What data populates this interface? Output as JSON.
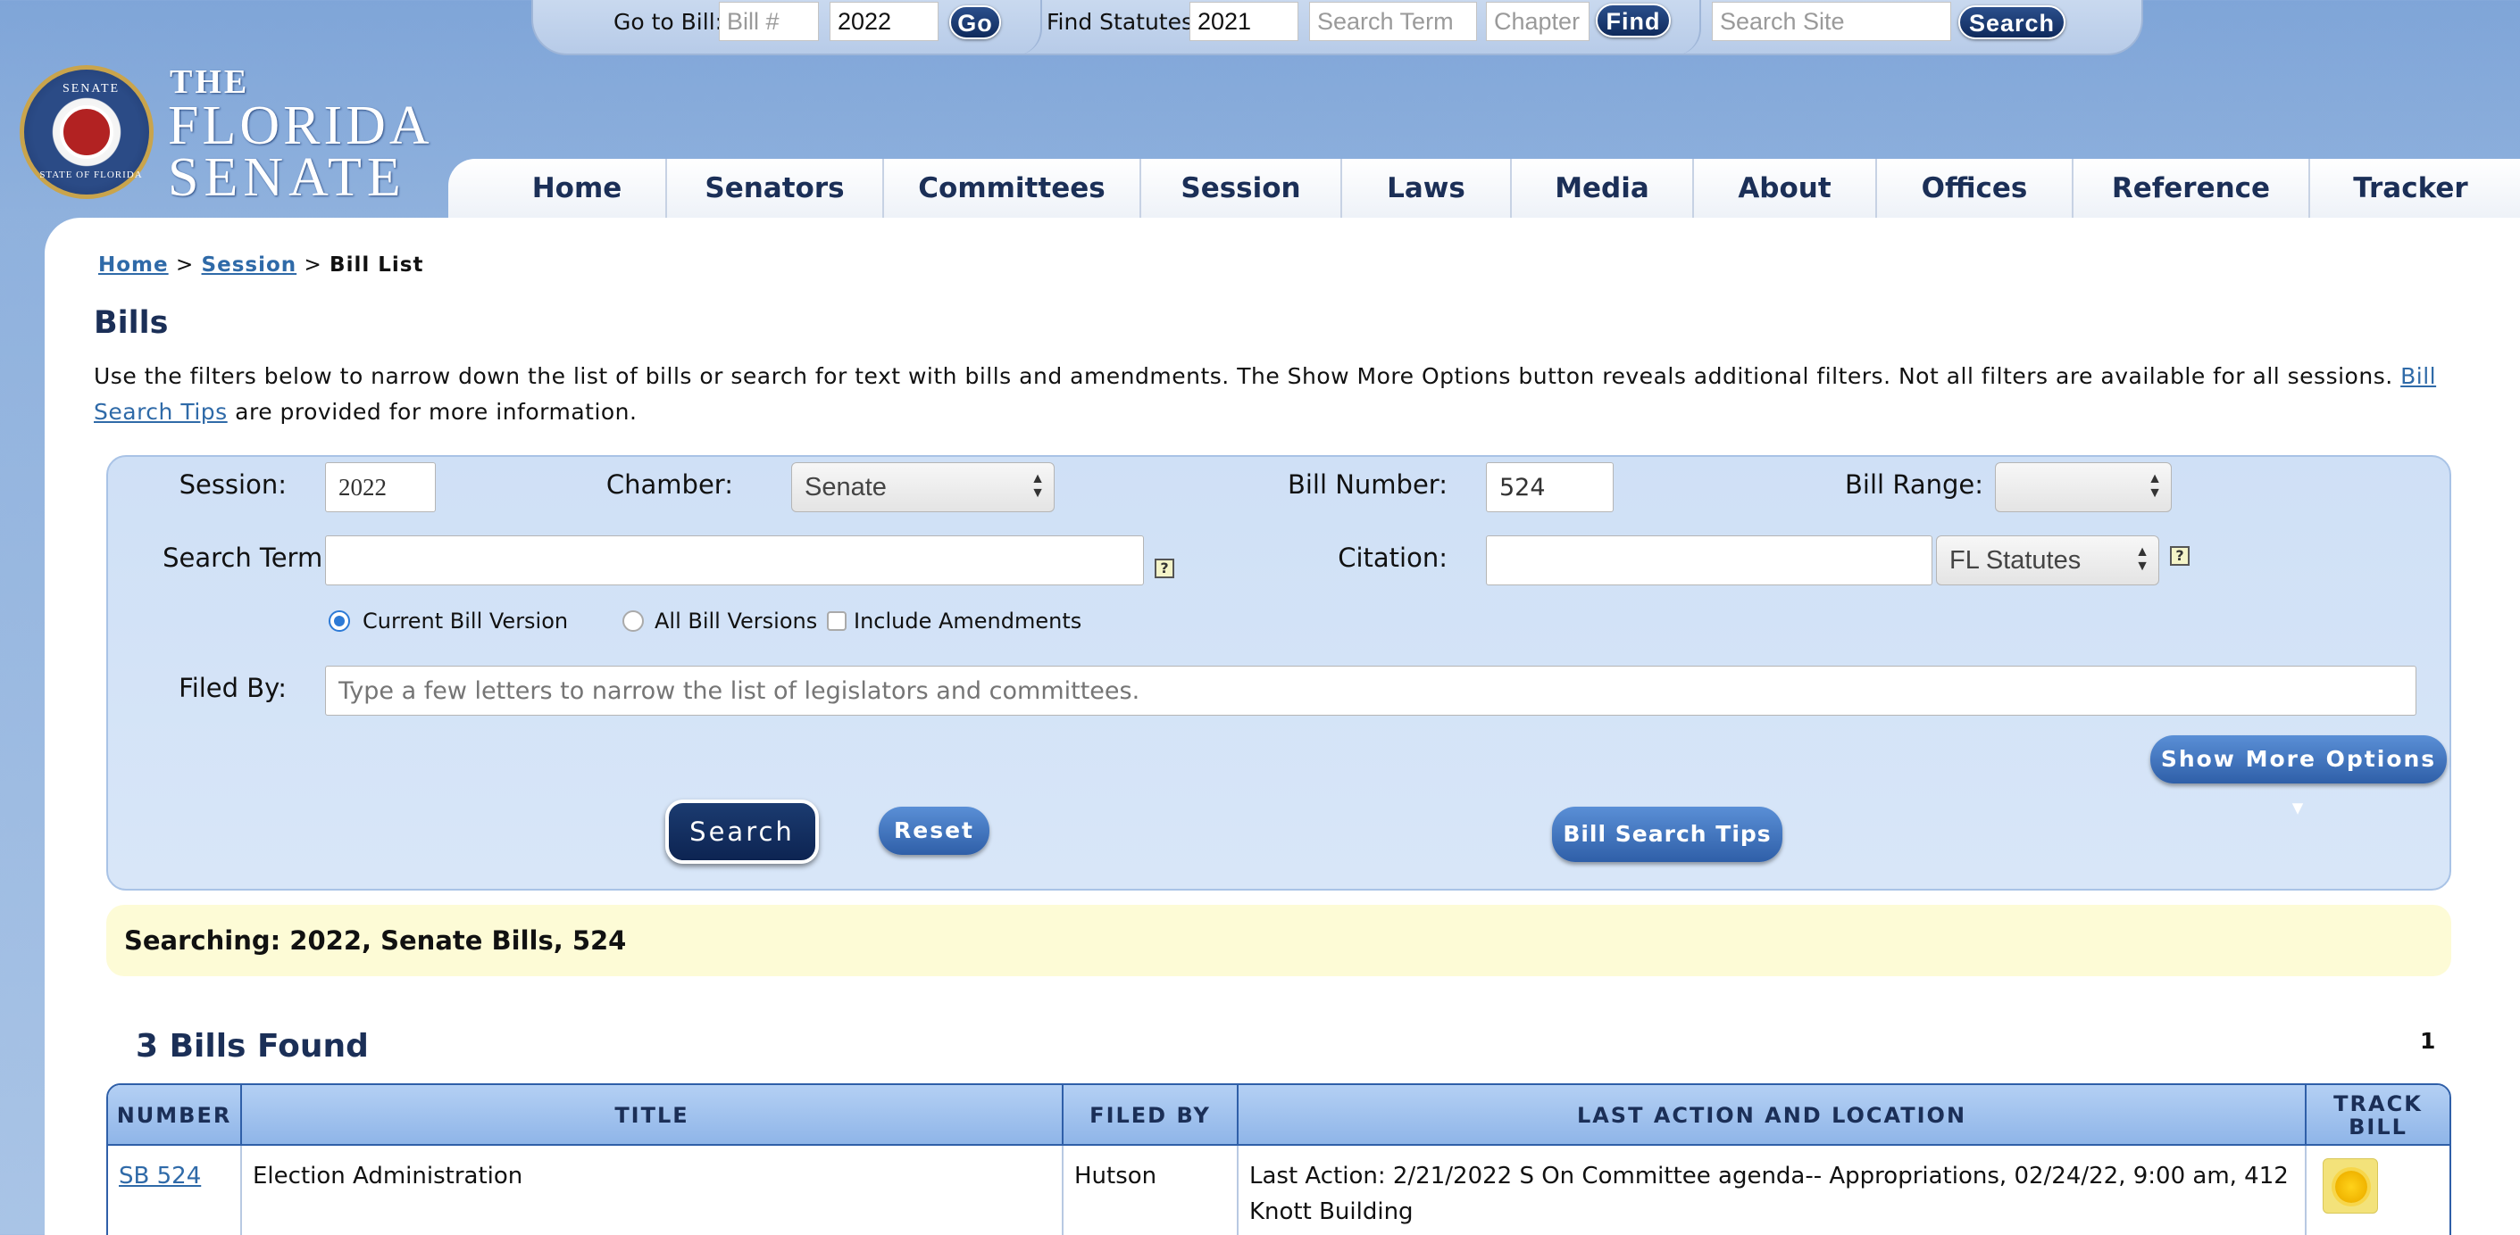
{
  "topbar": {
    "go_to_bill_label": "Go to Bill:",
    "bill_placeholder": "Bill #",
    "bill_year": "2022",
    "go_label": "Go",
    "find_statutes_label": "Find Statutes:",
    "statute_year": "2021",
    "search_term_placeholder": "Search Term",
    "chapter_placeholder": "Chapter",
    "find_label": "Find",
    "site_search_placeholder": "Search Site",
    "site_search_label": "Search"
  },
  "logo": {
    "the": "THE",
    "florida": "FLORIDA",
    "senate": "SENATE",
    "seal_top": "SENATE",
    "seal_bottom": "STATE OF FLORIDA"
  },
  "nav": {
    "items": [
      "Home",
      "Senators",
      "Committees",
      "Session",
      "Laws",
      "Media",
      "About",
      "Offices",
      "Reference",
      "Tracker"
    ]
  },
  "breadcrumb": {
    "home": "Home",
    "sep1": ">",
    "session": "Session",
    "sep2": ">",
    "current": "Bill List"
  },
  "page": {
    "title": "Bills",
    "intro_text": "Use the filters below to narrow down the list of bills or search for text with bills and amendments. The Show More Options button reveals additional filters.  Not all filters are available for all sessions.",
    "intro_link": "Bill Search Tips",
    "intro_tail": "are provided for more information."
  },
  "filters": {
    "session_label": "Session:",
    "session_value": "2022",
    "chamber_label": "Chamber:",
    "chamber_value": "Senate",
    "bill_number_label": "Bill Number:",
    "bill_number_value": "524",
    "bill_range_label": "Bill Range:",
    "bill_range_value": "",
    "search_term_label": "Search Term:",
    "search_term_value": "",
    "citation_label": "Citation:",
    "citation_value": "",
    "citation_type": "FL Statutes",
    "help_glyph": "?",
    "opt_current": "Current Bill Version",
    "opt_all": "All Bill Versions",
    "opt_amendments": "Include Amendments",
    "filed_by_label": "Filed By:",
    "filed_by_placeholder": "Type a few letters to narrow the list of legislators and committees.",
    "more_options_label": "Show More Options",
    "more_options_arrow": "▾",
    "search_button": "Search",
    "reset_button": "Reset",
    "tips_button": "Bill Search Tips"
  },
  "status": {
    "searching_text": "Searching: 2022, Senate Bills, 524",
    "found_text": "3 Bills Found",
    "page_number": "1"
  },
  "table": {
    "headers": [
      "NUMBER",
      "TITLE",
      "FILED BY",
      "LAST ACTION AND LOCATION",
      "TRACK BILL"
    ],
    "rows": [
      {
        "number": "SB 524",
        "title": "Election Administration",
        "filed_by": "Hutson",
        "last_action": "Last Action: 2/21/2022 S On Committee agenda-- Appropriations, 02/24/22, 9:00 am, 412 Knott Building",
        "track_icon": "sun-icon"
      }
    ]
  },
  "colors": {
    "brand_navy": "#1b2f57",
    "link_blue": "#2f6aa8",
    "panel_blue": "#cfe0f6",
    "status_yellow": "#fdfbd6"
  }
}
